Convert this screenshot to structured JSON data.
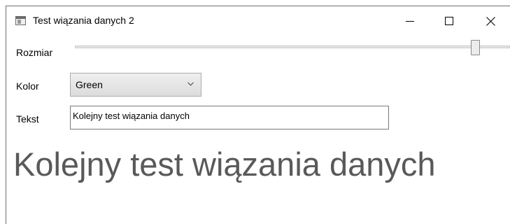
{
  "window": {
    "title": "Test wiązania danych 2",
    "icons": {
      "app": "window-app-icon",
      "minimize": "minimize-icon",
      "maximize": "maximize-icon",
      "close": "close-icon"
    }
  },
  "form": {
    "size_label": "Rozmiar",
    "size_slider_value_fraction": 0.93,
    "color_label": "Kolor",
    "color_selected": "Green",
    "text_label": "Tekst",
    "text_value": "Kolejny test wiązania danych"
  },
  "preview": {
    "text": "Kolejny test wiązania danych",
    "color": "#595959"
  },
  "colors": {
    "window_border": "#6f6f6f",
    "combo_border": "#acacac",
    "textbox_border": "#7a7a7a"
  }
}
